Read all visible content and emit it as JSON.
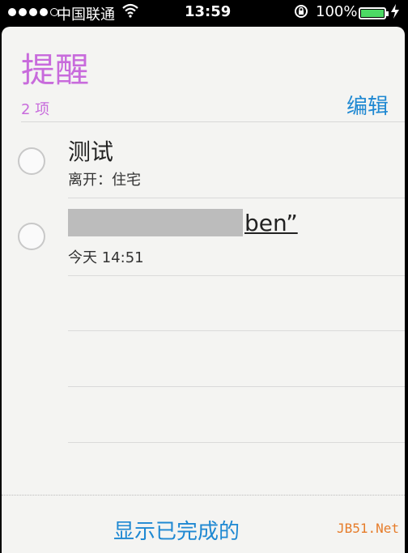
{
  "status": {
    "carrier": "中国联通",
    "time": "13:59",
    "battery_pct": "100%"
  },
  "list": {
    "title": "提醒",
    "count": "2 项",
    "edit": "编辑",
    "items": [
      {
        "title": "测试",
        "sub": "离开：住宅"
      },
      {
        "title": "ben”",
        "sub": "今天 14:51"
      }
    ],
    "show_completed": "显示已完成的"
  },
  "watermark": "JB51.Net",
  "colors": {
    "accent": "#c86bdc",
    "link": "#1e88d2",
    "battery": "#4cd964"
  }
}
